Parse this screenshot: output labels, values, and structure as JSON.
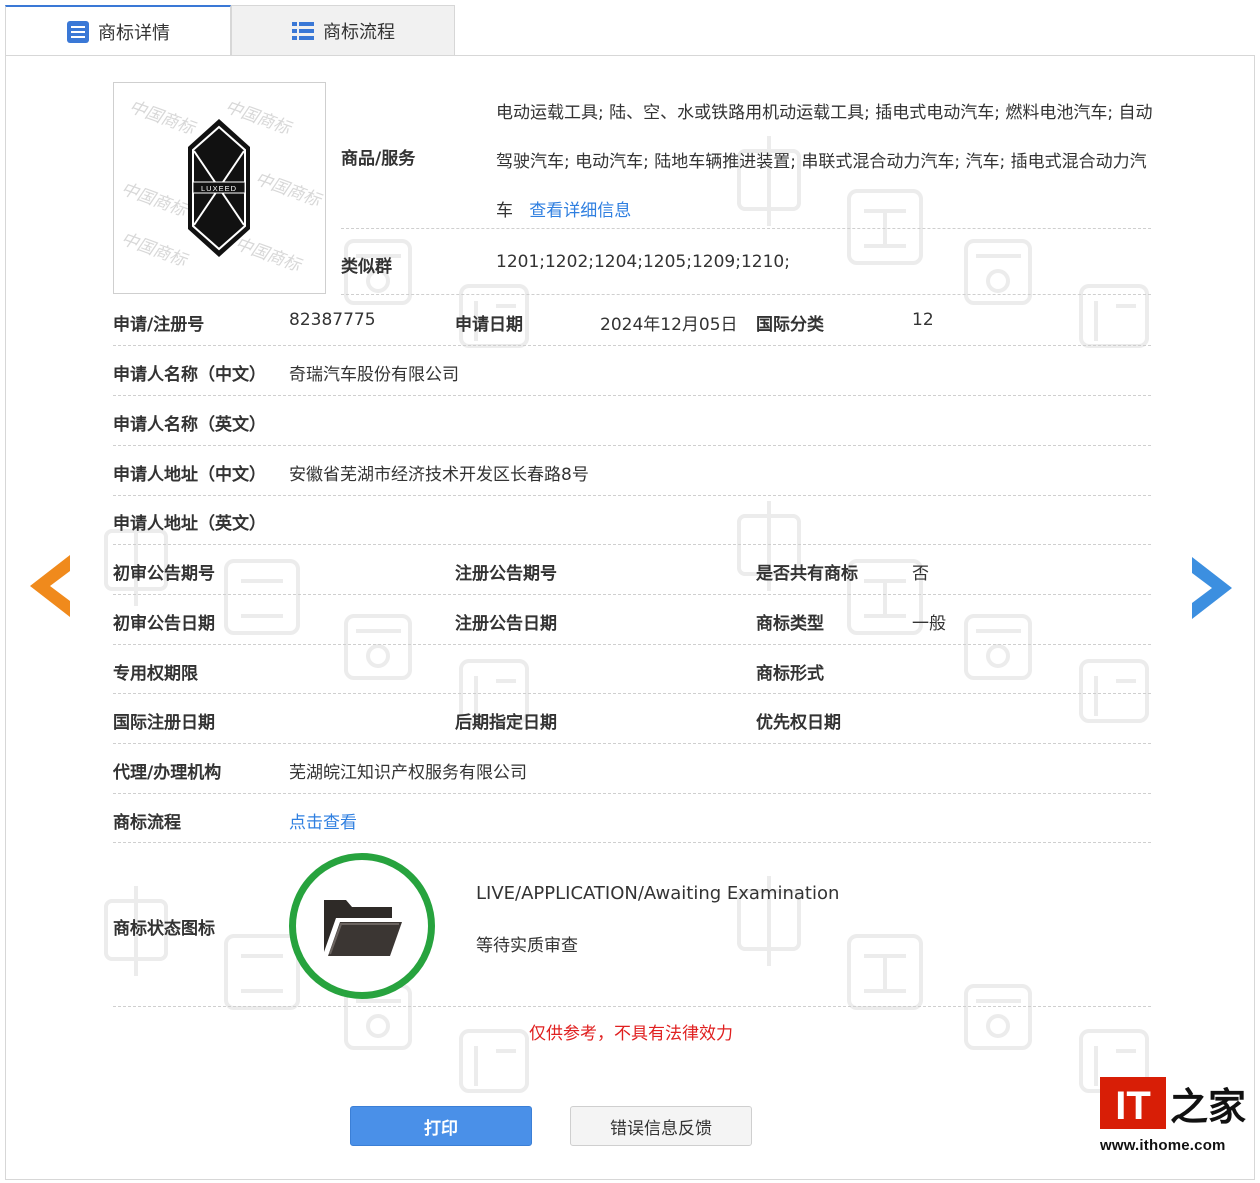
{
  "tabs": [
    {
      "label": "商标详情",
      "active": true
    },
    {
      "label": "商标流程",
      "active": false
    }
  ],
  "trademark": {
    "logo_text": "LUXEED",
    "logo_watermark": "中国商标"
  },
  "goods": {
    "label": "商品/服务",
    "value": "电动运载工具; 陆、空、水或铁路用机动运载工具; 插电式电动汽车; 燃料电池汽车; 自动驾驶汽车; 电动汽车; 陆地车辆推进装置; 串联式混合动力汽车; 汽车; 插电式混合动力汽车",
    "detail_link": "查看详细信息"
  },
  "similar_group": {
    "label": "类似群",
    "value": "1201;1202;1204;1205;1209;1210;"
  },
  "reg_number": {
    "label": "申请/注册号",
    "value": "82387775"
  },
  "app_date": {
    "label": "申请日期",
    "value": "2024年12月05日"
  },
  "intl_class": {
    "label": "国际分类",
    "value": "12"
  },
  "applicant_cn": {
    "label": "申请人名称（中文）",
    "value": "奇瑞汽车股份有限公司"
  },
  "applicant_en": {
    "label": "申请人名称（英文）",
    "value": ""
  },
  "address_cn": {
    "label": "申请人地址（中文）",
    "value": "安徽省芜湖市经济技术开发区长春路8号"
  },
  "address_en": {
    "label": "申请人地址（英文）",
    "value": ""
  },
  "prelim_issue": {
    "label": "初审公告期号",
    "value": ""
  },
  "reg_issue": {
    "label": "注册公告期号",
    "value": ""
  },
  "shared": {
    "label": "是否共有商标",
    "value": "否"
  },
  "prelim_date": {
    "label": "初审公告日期",
    "value": ""
  },
  "reg_date": {
    "label": "注册公告日期",
    "value": ""
  },
  "tm_type": {
    "label": "商标类型",
    "value": "一般"
  },
  "exclusive_term": {
    "label": "专用权期限",
    "value": ""
  },
  "tm_form": {
    "label": "商标形式",
    "value": ""
  },
  "intl_reg_date": {
    "label": "国际注册日期",
    "value": ""
  },
  "later_date": {
    "label": "后期指定日期",
    "value": ""
  },
  "priority_date": {
    "label": "优先权日期",
    "value": ""
  },
  "agent": {
    "label": "代理/办理机构",
    "value": "芜湖皖江知识产权服务有限公司"
  },
  "process": {
    "label": "商标流程",
    "link": "点击查看"
  },
  "status": {
    "label": "商标状态图标",
    "en": "LIVE/APPLICATION/Awaiting Examination",
    "cn": "等待实质审查",
    "ring_color": "#27a33e"
  },
  "disclaimer": "仅供参考，不具有法律效力",
  "buttons": {
    "print": "打印",
    "feedback": "错误信息反馈"
  },
  "watermark": {
    "chars": [
      "中",
      "国",
      "商",
      "标"
    ]
  },
  "ithome": {
    "logo_it": "IT",
    "logo_home": "之家",
    "url": "www.ithome.com"
  },
  "colors": {
    "link": "#2f7fe0",
    "disclaimer": "#e02020",
    "primary": "#4a90e8",
    "arrow_left": "#f08a1c",
    "arrow_right": "#3c8fe0"
  }
}
